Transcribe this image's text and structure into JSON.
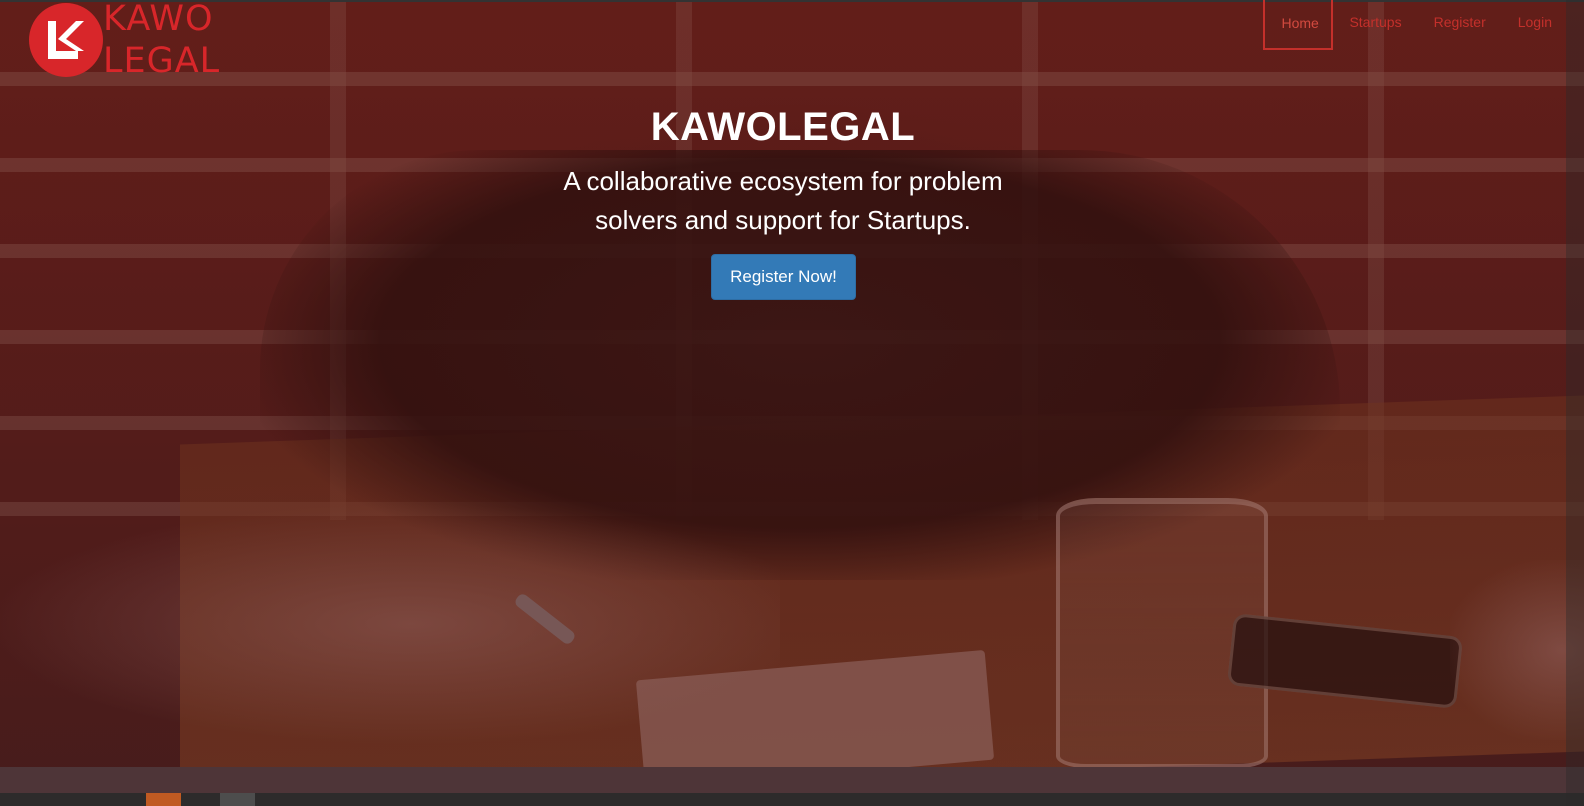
{
  "brand": {
    "logo_top": "KAWO",
    "logo_bottom": "LEGAL",
    "brand_color": "#d8262a"
  },
  "nav": {
    "items": [
      {
        "label": "Home",
        "active": true
      },
      {
        "label": "Startups",
        "active": false
      },
      {
        "label": "Register",
        "active": false
      },
      {
        "label": "Login",
        "active": false
      }
    ],
    "link_color": "#c4302b"
  },
  "hero": {
    "title": "KAWOLEGAL",
    "tagline": "A collaborative ecosystem for problem solvers and support for Startups.",
    "cta_label": "Register Now!",
    "cta_color": "#337ab7"
  }
}
